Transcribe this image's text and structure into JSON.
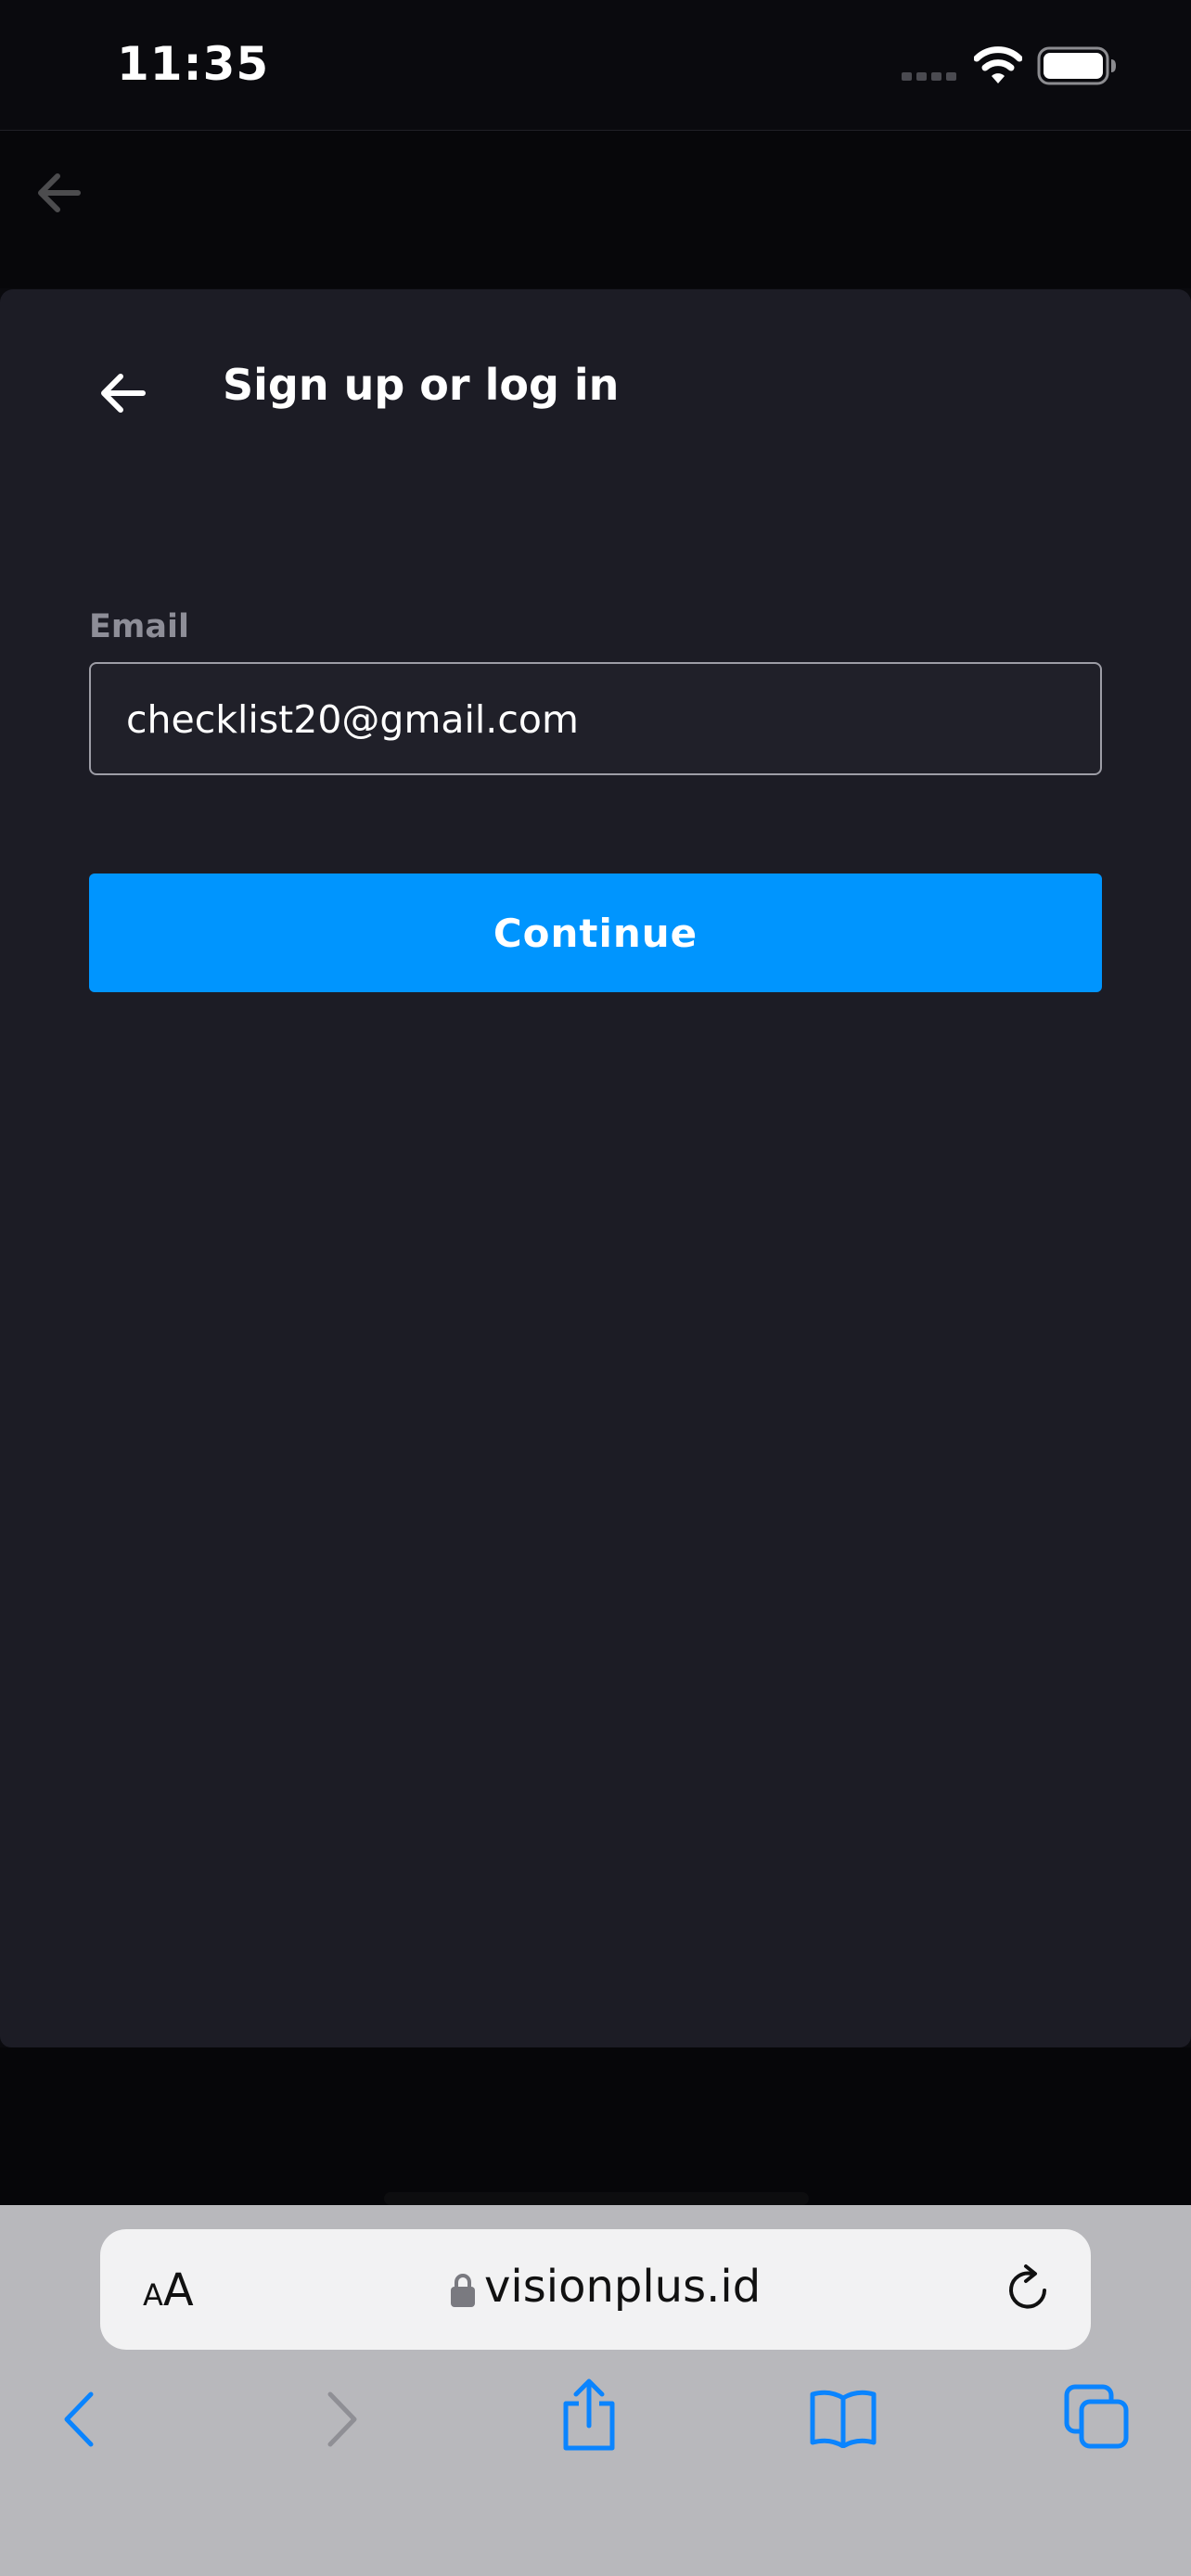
{
  "status_bar": {
    "time": "11:35",
    "icons": [
      "cellular-signal-icon",
      "wifi-icon",
      "battery-icon"
    ]
  },
  "modal": {
    "title": "Sign up or log in",
    "back_icon": "arrow-left-icon",
    "email": {
      "label": "Email",
      "value": "checklist20@gmail.com"
    },
    "continue_label": "Continue",
    "colors": {
      "accent": "#0095fe",
      "background": "#1c1c25"
    }
  },
  "browser": {
    "text_size_label_small": "A",
    "text_size_label_large": "A",
    "url": "visionplus.id",
    "toolbar_icons": [
      "back-icon",
      "forward-icon",
      "share-icon",
      "bookmarks-icon",
      "tabs-icon"
    ],
    "accent": "#0a84ff"
  }
}
